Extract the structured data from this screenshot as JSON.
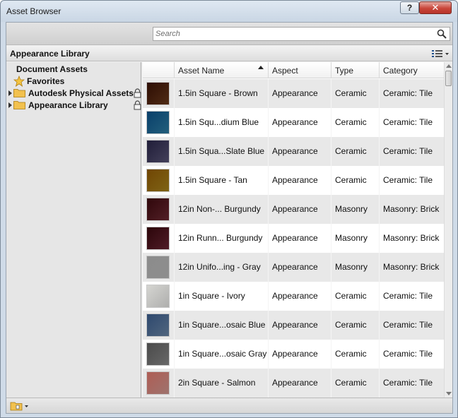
{
  "window": {
    "title": "Asset Browser",
    "help_label": "?",
    "close_label": "✕"
  },
  "search": {
    "placeholder": "Search"
  },
  "library_header": {
    "title": "Appearance Library"
  },
  "tree": {
    "items": [
      {
        "label": "Document Assets"
      },
      {
        "label": "Favorites"
      },
      {
        "label": "Autodesk Physical Assets"
      },
      {
        "label": "Appearance Library"
      }
    ]
  },
  "grid": {
    "columns": [
      "Asset Name",
      "Aspect",
      "Type",
      "Category"
    ],
    "sort": {
      "column": "Asset Name",
      "direction": "ascending"
    },
    "rows": [
      {
        "name": "1.5in Square - Brown",
        "aspect": "Appearance",
        "type": "Ceramic",
        "category": "Ceramic: Tile",
        "swatch": "#6b3a1c"
      },
      {
        "name": "1.5in Squ...dium Blue",
        "aspect": "Appearance",
        "type": "Ceramic",
        "category": "Ceramic: Tile",
        "swatch": "#2f7fa5"
      },
      {
        "name": "1.5in Squa...Slate Blue",
        "aspect": "Appearance",
        "type": "Ceramic",
        "category": "Ceramic: Tile",
        "swatch": "#5a5678"
      },
      {
        "name": "1.5in Square - Tan",
        "aspect": "Appearance",
        "type": "Ceramic",
        "category": "Ceramic: Tile",
        "swatch": "#a9851d"
      },
      {
        "name": "12in Non-... Burgundy",
        "aspect": "Appearance",
        "type": "Masonry",
        "category": "Masonry: Brick",
        "swatch": "#6e2a34"
      },
      {
        "name": "12in Runn... Burgundy",
        "aspect": "Appearance",
        "type": "Masonry",
        "category": "Masonry: Brick",
        "swatch": "#6a2634"
      },
      {
        "name": "12in Unifo...ing - Gray",
        "aspect": "Appearance",
        "type": "Masonry",
        "category": "Masonry: Brick",
        "swatch": "#bdbdbd"
      },
      {
        "name": "1in Square - Ivory",
        "aspect": "Appearance",
        "type": "Ceramic",
        "category": "Ceramic: Tile",
        "swatch": "#e9e9e7"
      },
      {
        "name": "1in Square...osaic Blue",
        "aspect": "Appearance",
        "type": "Ceramic",
        "category": "Ceramic: Tile",
        "swatch": "#6c88a8"
      },
      {
        "name": "1in Square...osaic Gray",
        "aspect": "Appearance",
        "type": "Ceramic",
        "category": "Ceramic: Tile",
        "swatch": "#8a8a8a"
      },
      {
        "name": "2in Square - Salmon",
        "aspect": "Appearance",
        "type": "Ceramic",
        "category": "Ceramic: Tile",
        "swatch": "#d39a93"
      }
    ]
  }
}
